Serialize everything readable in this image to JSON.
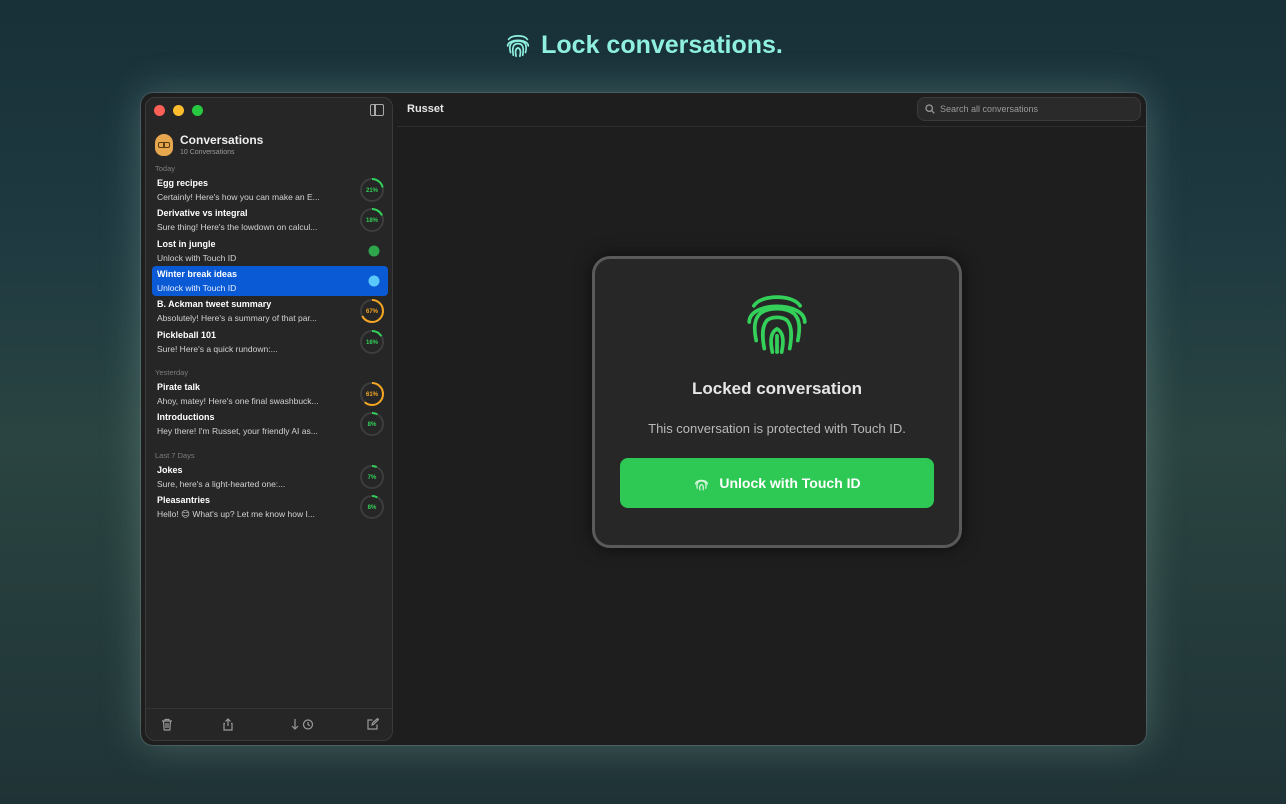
{
  "headline": {
    "text": "Lock conversations.",
    "icon": "fingerprint-icon",
    "color": "#8ff0e0"
  },
  "sidebar": {
    "title": "Conversations",
    "count": "10 Conversations",
    "sections": [
      {
        "label": "Today",
        "items": [
          {
            "title": "Egg recipes",
            "preview": "Certainly! Here's how you can make an E...",
            "badge": "21%",
            "progress": 0.21,
            "color": "#32d158"
          },
          {
            "title": "Derivative vs integral",
            "preview": "Sure thing! Here's the lowdown on calcul...",
            "badge": "18%",
            "progress": 0.18,
            "color": "#32d158"
          },
          {
            "title": "Lost in jungle",
            "preview": "Unlock with Touch ID",
            "locked": true,
            "color": "#32d158"
          },
          {
            "title": "Winter break ideas",
            "preview": "Unlock with Touch ID",
            "locked": true,
            "selected": true,
            "color": "#5ac8fa"
          },
          {
            "title": "B. Ackman tweet summary",
            "preview": "Absolutely! Here's a summary of that par...",
            "badge": "67%",
            "progress": 0.67,
            "color": "#f5a623"
          },
          {
            "title": "Pickleball 101",
            "preview": "Sure! Here's a quick rundown:...",
            "badge": "16%",
            "progress": 0.16,
            "color": "#32d158"
          }
        ]
      },
      {
        "label": "Yesterday",
        "items": [
          {
            "title": "Pirate talk",
            "preview": "Ahoy, matey! Here's one final swashbuck...",
            "badge": "61%",
            "progress": 0.61,
            "color": "#f5a623"
          },
          {
            "title": "Introductions",
            "preview": "Hey there! I'm Russet, your friendly AI as...",
            "badge": "8%",
            "progress": 0.08,
            "color": "#32d158"
          }
        ]
      },
      {
        "label": "Last 7 Days",
        "items": [
          {
            "title": "Jokes",
            "preview": "Sure, here's a light-hearted one:...",
            "badge": "7%",
            "progress": 0.07,
            "color": "#32d158"
          },
          {
            "title": "Pleasantries",
            "preview": "Hello! 😊 What's up? Let me know how I...",
            "badge": "8%",
            "progress": 0.08,
            "color": "#32d158"
          }
        ]
      }
    ]
  },
  "main": {
    "title": "Russet",
    "search_placeholder": "Search all conversations",
    "lock": {
      "title": "Locked conversation",
      "description": "This conversation is protected with Touch ID.",
      "button_label": "Unlock with Touch ID",
      "accent": "#2ec954"
    }
  }
}
